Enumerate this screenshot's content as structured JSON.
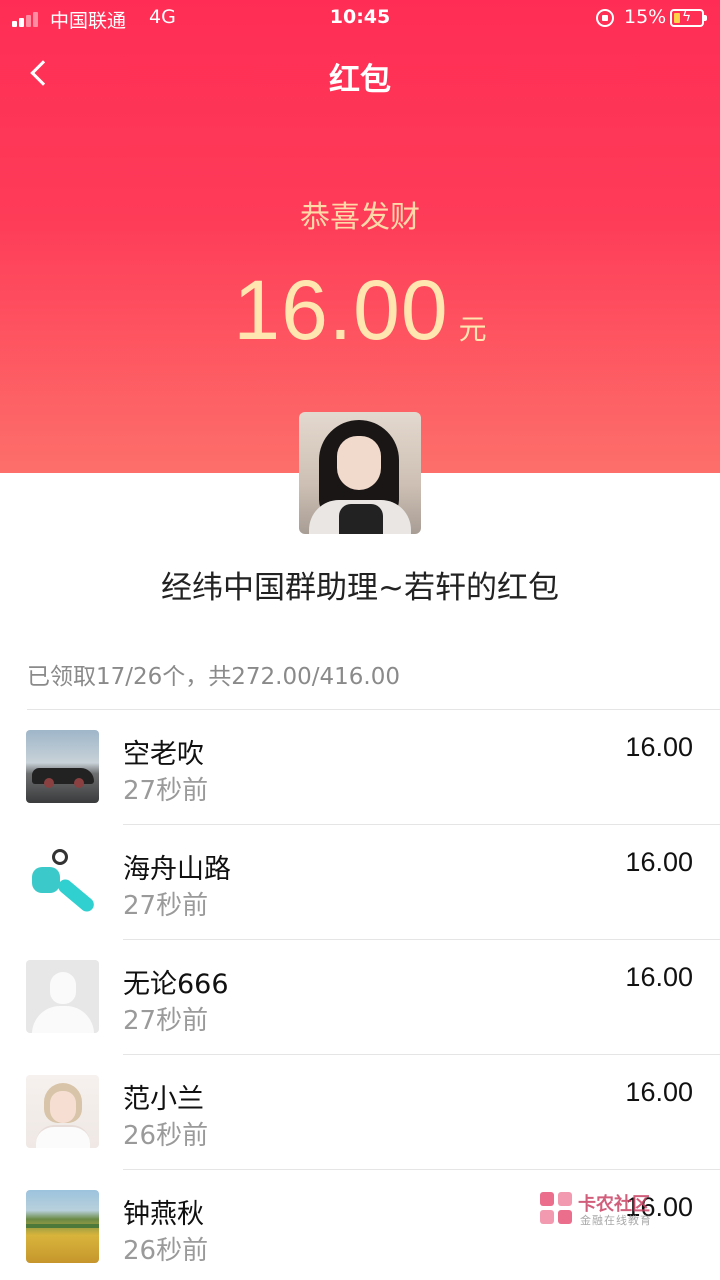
{
  "status_bar": {
    "carrier": "中国联通",
    "network": "4G",
    "time": "10:45",
    "battery": "15%"
  },
  "nav": {
    "title": "红包",
    "back_icon": "chevron-left-icon"
  },
  "packet": {
    "greeting": "恭喜发财",
    "amount": "16.00",
    "unit": "元",
    "title": "经纬中国群助理~若轩的红包",
    "summary": "已领取17/26个，共272.00/416.00"
  },
  "recipients": [
    {
      "name": "空老吹",
      "time": "27秒前",
      "amount": "16.00",
      "avatar": "car"
    },
    {
      "name": "海舟山路",
      "time": "27秒前",
      "amount": "16.00",
      "avatar": "keychain"
    },
    {
      "name": "无论666",
      "time": "27秒前",
      "amount": "16.00",
      "avatar": "default"
    },
    {
      "name": "范小兰",
      "time": "26秒前",
      "amount": "16.00",
      "avatar": "bride"
    },
    {
      "name": "钟燕秋",
      "time": "26秒前",
      "amount": "16.00",
      "avatar": "field"
    }
  ],
  "watermark": {
    "name": "卡农社区",
    "tagline": "金融在线教育"
  },
  "colors": {
    "header_top": "#ff2d55",
    "header_bottom": "#fd6f6a",
    "amount_text": "#ffe6b0"
  }
}
